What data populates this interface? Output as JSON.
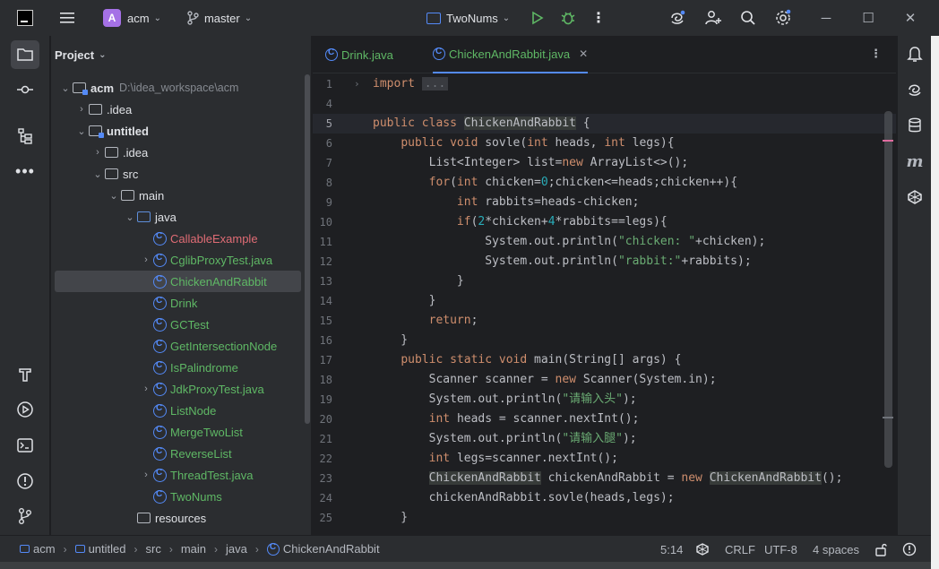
{
  "titlebar": {
    "project_initial": "A",
    "project_name": "acm",
    "branch": "master",
    "run_config": "TwoNums",
    "colors": {
      "project_badge": "#a571e6",
      "run": "#5fb865",
      "accent": "#548af7"
    }
  },
  "project_panel": {
    "title": "Project",
    "tree": [
      {
        "label": "acm",
        "path": "D:\\idea_workspace\\acm",
        "type": "module",
        "expanded": true,
        "level": 0,
        "bold": true
      },
      {
        "label": ".idea",
        "type": "folder",
        "expanded": false,
        "level": 1
      },
      {
        "label": "untitled",
        "type": "module",
        "expanded": true,
        "level": 1,
        "bold": true
      },
      {
        "label": ".idea",
        "type": "folder",
        "expanded": false,
        "level": 2
      },
      {
        "label": "src",
        "type": "folder",
        "expanded": true,
        "level": 2
      },
      {
        "label": "main",
        "type": "folder",
        "expanded": true,
        "level": 3
      },
      {
        "label": "java",
        "type": "source-folder",
        "expanded": true,
        "level": 4
      },
      {
        "label": "CallableExample",
        "type": "class",
        "color": "red",
        "level": 5
      },
      {
        "label": "CglibProxyTest.java",
        "type": "class",
        "color": "green",
        "expandable": true,
        "level": 5
      },
      {
        "label": "ChickenAndRabbit",
        "type": "class",
        "color": "green",
        "selected": true,
        "level": 5
      },
      {
        "label": "Drink",
        "type": "class",
        "color": "green",
        "level": 5
      },
      {
        "label": "GCTest",
        "type": "class",
        "color": "green",
        "level": 5
      },
      {
        "label": "GetIntersectionNode",
        "type": "class",
        "color": "green",
        "level": 5
      },
      {
        "label": "IsPalindrome",
        "type": "class",
        "color": "green",
        "level": 5
      },
      {
        "label": "JdkProxyTest.java",
        "type": "class",
        "color": "green",
        "expandable": true,
        "level": 5
      },
      {
        "label": "ListNode",
        "type": "class",
        "color": "green",
        "level": 5
      },
      {
        "label": "MergeTwoList",
        "type": "class",
        "color": "green",
        "level": 5
      },
      {
        "label": "ReverseList",
        "type": "class",
        "color": "green",
        "level": 5
      },
      {
        "label": "ThreadTest.java",
        "type": "class",
        "color": "green",
        "expandable": true,
        "level": 5
      },
      {
        "label": "TwoNums",
        "type": "class",
        "color": "green",
        "level": 5
      },
      {
        "label": "resources",
        "type": "folder",
        "level": 4
      }
    ]
  },
  "editor": {
    "tabs": [
      {
        "label": "Drink.java",
        "active": false
      },
      {
        "label": "ChickenAndRabbit.java",
        "active": true
      }
    ],
    "lines": [
      {
        "n": "1",
        "folded": true,
        "tokens": [
          [
            "kw",
            "import "
          ],
          [
            "fold",
            "..."
          ]
        ]
      },
      {
        "n": "4",
        "tokens": []
      },
      {
        "n": "5",
        "current": true,
        "tokens": [
          [
            "kw",
            "public class "
          ],
          [
            "hl",
            "ChickenAndRabbit"
          ],
          [
            "p",
            " {"
          ]
        ]
      },
      {
        "n": "6",
        "tokens": [
          [
            "p",
            "    "
          ],
          [
            "kw",
            "public void "
          ],
          [
            "p",
            "sovle("
          ],
          [
            "kw",
            "int "
          ],
          [
            "p",
            "heads, "
          ],
          [
            "kw",
            "int "
          ],
          [
            "p",
            "legs){"
          ]
        ]
      },
      {
        "n": "7",
        "tokens": [
          [
            "p",
            "        List<Integer> list="
          ],
          [
            "kw",
            "new "
          ],
          [
            "p",
            "ArrayList<>();"
          ]
        ]
      },
      {
        "n": "8",
        "tokens": [
          [
            "p",
            "        "
          ],
          [
            "kw",
            "for"
          ],
          [
            "p",
            "("
          ],
          [
            "kw",
            "int "
          ],
          [
            "p",
            "chicken="
          ],
          [
            "num",
            "0"
          ],
          [
            "p",
            ";chicken<=heads;chicken++){"
          ]
        ]
      },
      {
        "n": "9",
        "tokens": [
          [
            "p",
            "            "
          ],
          [
            "kw",
            "int "
          ],
          [
            "p",
            "rabbits=heads-chicken;"
          ]
        ]
      },
      {
        "n": "10",
        "tokens": [
          [
            "p",
            "            "
          ],
          [
            "kw",
            "if"
          ],
          [
            "p",
            "("
          ],
          [
            "num",
            "2"
          ],
          [
            "p",
            "*chicken+"
          ],
          [
            "num",
            "4"
          ],
          [
            "p",
            "*rabbits==legs){"
          ]
        ]
      },
      {
        "n": "11",
        "tokens": [
          [
            "p",
            "                System.out.println("
          ],
          [
            "str",
            "\"chicken: \""
          ],
          [
            "p",
            "+chicken);"
          ]
        ]
      },
      {
        "n": "12",
        "tokens": [
          [
            "p",
            "                System.out.println("
          ],
          [
            "str",
            "\"rabbit:\""
          ],
          [
            "p",
            "+rabbits);"
          ]
        ]
      },
      {
        "n": "13",
        "tokens": [
          [
            "p",
            "            }"
          ]
        ]
      },
      {
        "n": "14",
        "tokens": [
          [
            "p",
            "        }"
          ]
        ]
      },
      {
        "n": "15",
        "tokens": [
          [
            "p",
            "        "
          ],
          [
            "kw",
            "return"
          ],
          [
            "p",
            ";"
          ]
        ]
      },
      {
        "n": "16",
        "tokens": [
          [
            "p",
            "    }"
          ]
        ]
      },
      {
        "n": "17",
        "tokens": [
          [
            "p",
            "    "
          ],
          [
            "kw",
            "public static void "
          ],
          [
            "p",
            "main(String[] args) {"
          ]
        ]
      },
      {
        "n": "18",
        "tokens": [
          [
            "p",
            "        Scanner scanner = "
          ],
          [
            "kw",
            "new "
          ],
          [
            "p",
            "Scanner(System.in);"
          ]
        ]
      },
      {
        "n": "19",
        "tokens": [
          [
            "p",
            "        System.out.println("
          ],
          [
            "str",
            "\"请输入头\""
          ],
          [
            "p",
            ");"
          ]
        ]
      },
      {
        "n": "20",
        "tokens": [
          [
            "p",
            "        "
          ],
          [
            "kw",
            "int "
          ],
          [
            "p",
            "heads = scanner.nextInt();"
          ]
        ]
      },
      {
        "n": "21",
        "tokens": [
          [
            "p",
            "        System.out.println("
          ],
          [
            "str",
            "\"请输入腿\""
          ],
          [
            "p",
            ");"
          ]
        ]
      },
      {
        "n": "22",
        "tokens": [
          [
            "p",
            "        "
          ],
          [
            "kw",
            "int "
          ],
          [
            "p",
            "legs=scanner.nextInt();"
          ]
        ]
      },
      {
        "n": "23",
        "tokens": [
          [
            "p",
            "        "
          ],
          [
            "hl",
            "ChickenAndRabbit"
          ],
          [
            "p",
            " chickenAndRabbit = "
          ],
          [
            "kw",
            "new "
          ],
          [
            "hl",
            "ChickenAndRabbit"
          ],
          [
            "p",
            "();"
          ]
        ]
      },
      {
        "n": "24",
        "tokens": [
          [
            "p",
            "        chickenAndRabbit.sovle(heads,legs);"
          ]
        ]
      },
      {
        "n": "25",
        "tokens": [
          [
            "p",
            "    }"
          ]
        ]
      }
    ]
  },
  "statusbar": {
    "breadcrumbs": [
      "acm",
      "untitled",
      "src",
      "main",
      "java",
      "ChickenAndRabbit"
    ],
    "position": "5:14",
    "line_sep": "CRLF",
    "encoding": "UTF-8",
    "indent": "4 spaces"
  },
  "icons": {
    "left_strip": [
      "folder-icon",
      "commit-icon",
      "structure-icon",
      "more-icon",
      "build-icon",
      "run-icon",
      "terminal-icon",
      "problems-icon",
      "git-icon"
    ],
    "right_strip": [
      "notifications-icon",
      "ai-assistant-icon",
      "database-icon",
      "maven-icon",
      "plugin-icon"
    ]
  }
}
